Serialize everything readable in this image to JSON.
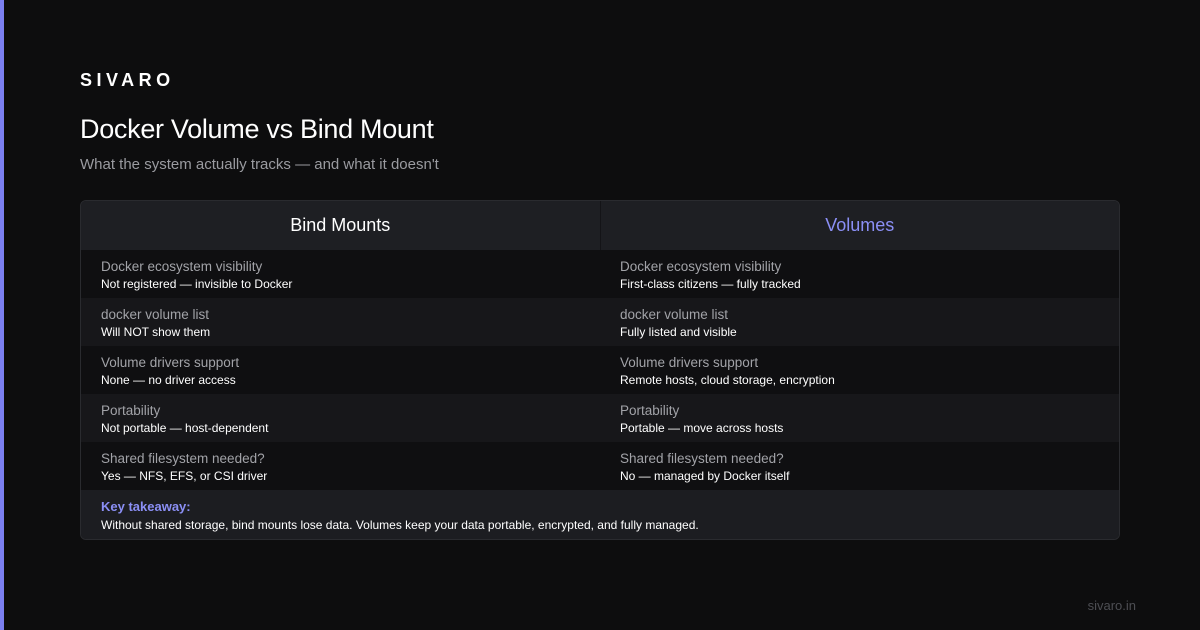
{
  "brand": "SIVARO",
  "title": "Docker Volume vs Bind Mount",
  "subtitle": "What the system actually tracks — and what it doesn't",
  "colors": {
    "accent": "#7b7ff0",
    "highlight": "#8b8ff5",
    "background": "#0d0d0e"
  },
  "table": {
    "headers": [
      "Bind Mounts",
      "Volumes"
    ],
    "rows": [
      {
        "left": {
          "label": "Docker ecosystem visibility",
          "value": "Not registered — invisible to Docker"
        },
        "right": {
          "label": "Docker ecosystem visibility",
          "value": "First-class citizens — fully tracked"
        }
      },
      {
        "left": {
          "label": "docker volume list",
          "value": "Will NOT show them"
        },
        "right": {
          "label": "docker volume list",
          "value": "Fully listed and visible"
        }
      },
      {
        "left": {
          "label": "Volume drivers support",
          "value": "None — no driver access"
        },
        "right": {
          "label": "Volume drivers support",
          "value": "Remote hosts, cloud storage, encryption"
        }
      },
      {
        "left": {
          "label": "Portability",
          "value": "Not portable — host-dependent"
        },
        "right": {
          "label": "Portability",
          "value": "Portable — move across hosts"
        }
      },
      {
        "left": {
          "label": "Shared filesystem needed?",
          "value": "Yes — NFS, EFS, or CSI driver"
        },
        "right": {
          "label": "Shared filesystem needed?",
          "value": "No — managed by Docker itself"
        }
      }
    ],
    "takeaway": {
      "label": "Key takeaway:",
      "text": "Without shared storage, bind mounts lose data. Volumes keep your data portable, encrypted, and fully managed."
    }
  },
  "footer": "sivaro.in"
}
